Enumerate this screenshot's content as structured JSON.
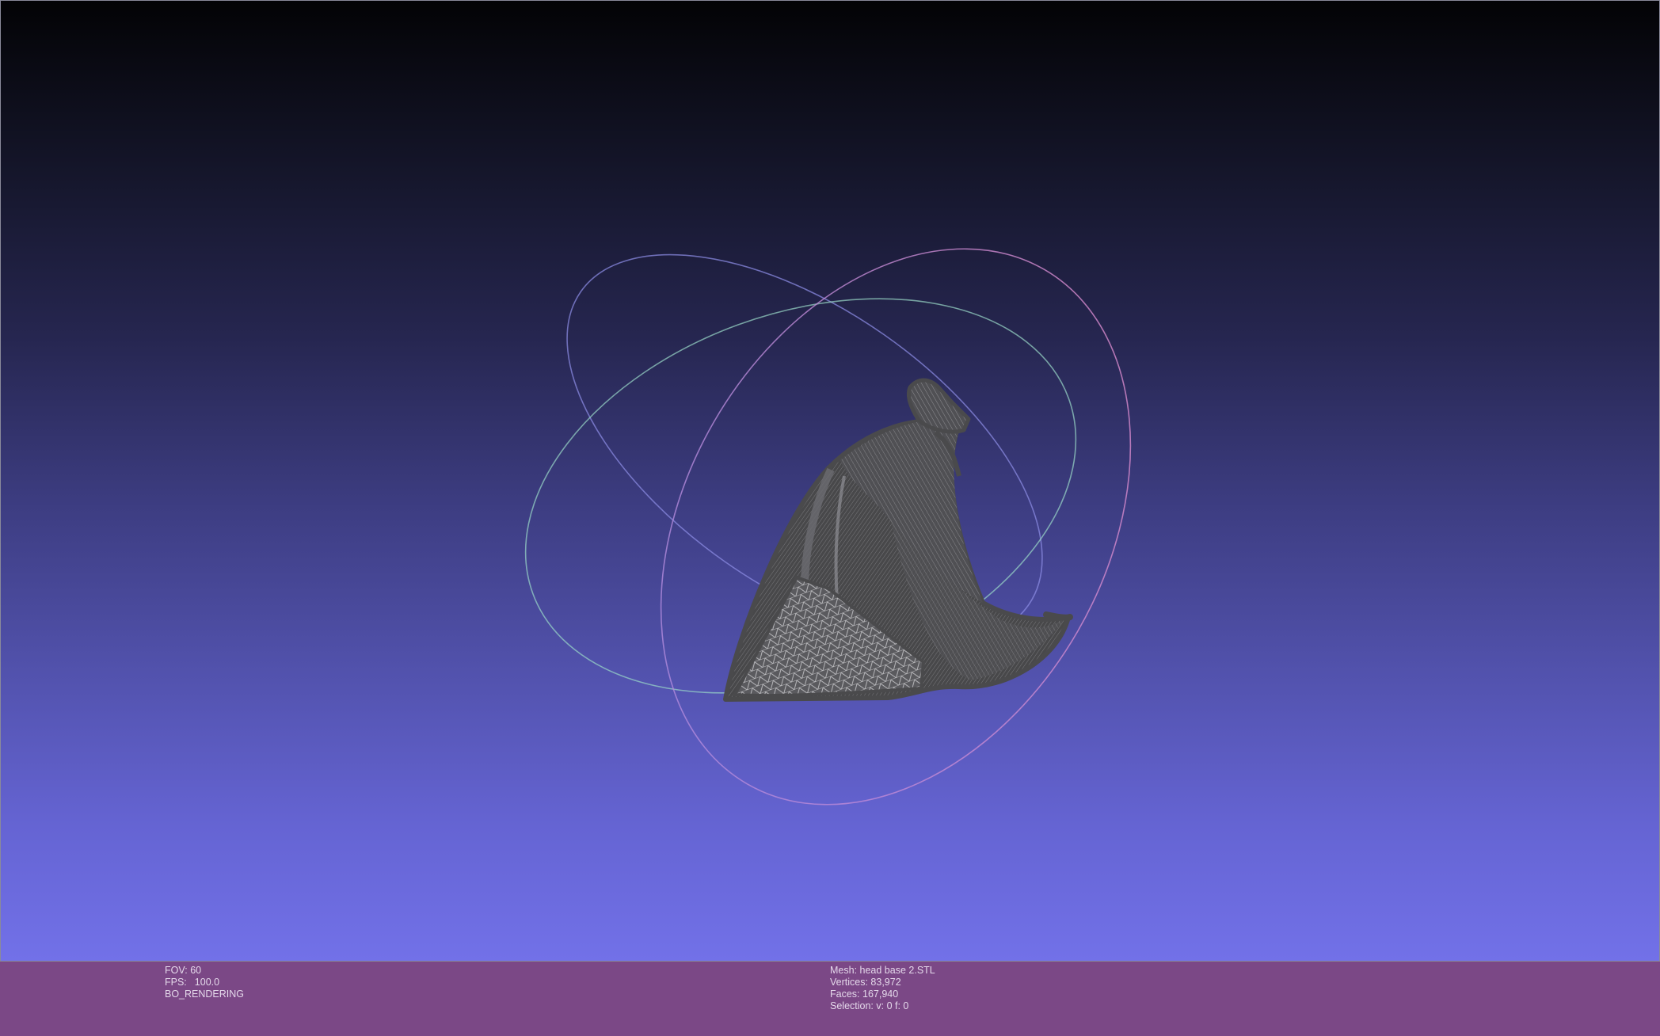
{
  "viewport": {
    "mesh_color": "#4c4c4e",
    "trackball_colors": {
      "x_ring": "#d98ac9",
      "y_ring": "#9ad8c8",
      "z_ring": "#8a8ae0"
    }
  },
  "status": {
    "left": {
      "fov_label": "FOV:",
      "fov_value": "60",
      "fps_label": "FPS:",
      "fps_value": "100.0",
      "render_mode": "BO_RENDERING"
    },
    "center": {
      "mesh_label": "Mesh:",
      "mesh_value": "head base 2.STL",
      "vertices_label": "Vertices:",
      "vertices_value": "83,972",
      "faces_label": "Faces:",
      "faces_value": "167,940",
      "selection_label": "Selection:",
      "selection_value": "v: 0 f: 0"
    }
  }
}
